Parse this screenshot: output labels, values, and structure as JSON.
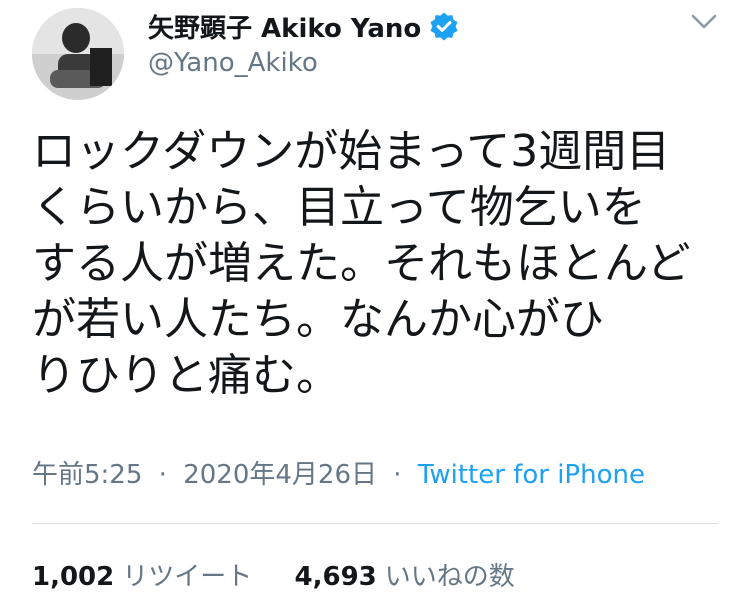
{
  "user": {
    "display_name": "矢野顕子 Akiko Yano",
    "handle": "@Yano_Akiko",
    "verified": true
  },
  "tweet": {
    "text": "ロックダウンが始まって3週間目\nくらいから、目立って物乞いを\nする人が増えた。それもほとんど\nが若い人たち。なんか心がひ\nりひりと痛む。"
  },
  "meta": {
    "time": "午前5:25",
    "separator": "·",
    "date": "2020年4月26日",
    "source": "Twitter for iPhone"
  },
  "stats": {
    "retweets_count": "1,002",
    "retweets_label": "リツイート",
    "likes_count": "4,693",
    "likes_label": "いいねの数"
  },
  "colors": {
    "accent": "#1da1f2",
    "secondary_text": "#657786",
    "primary_text": "#14171a"
  },
  "icons": {
    "verified": "verified-badge-icon",
    "caret": "chevron-down-icon"
  }
}
